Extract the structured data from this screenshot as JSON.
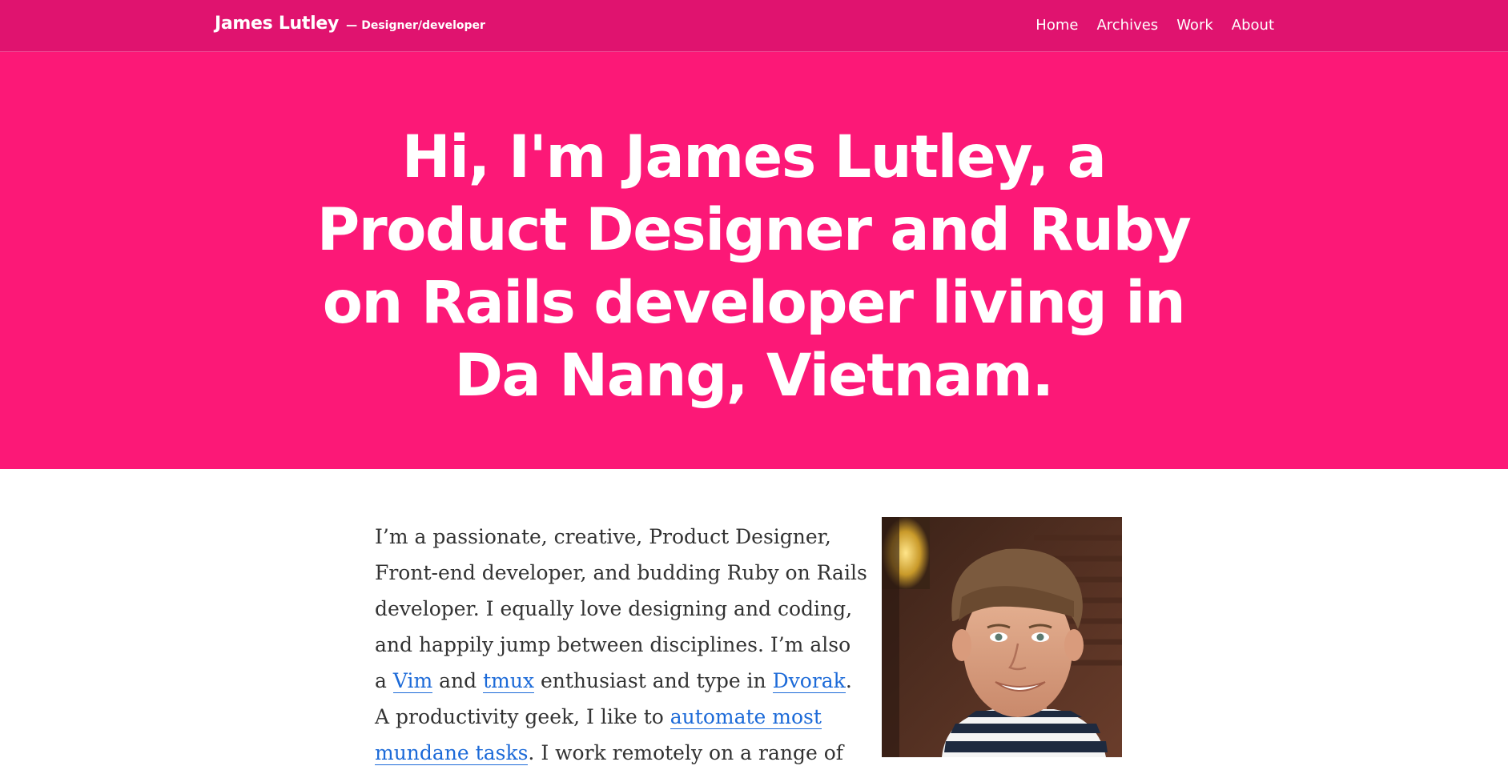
{
  "header": {
    "brand_name": "James Lutley",
    "brand_dash": "—",
    "brand_tagline": "Designer/developer",
    "nav": [
      {
        "label": "Home"
      },
      {
        "label": "Archives"
      },
      {
        "label": "Work"
      },
      {
        "label": "About"
      }
    ]
  },
  "hero": {
    "title": "Hi, I'm James Lutley, a Product Designer and Ruby on Rails developer living in Da Nang, Vietnam."
  },
  "intro": {
    "text_1": "I’m a passionate, creative, Product Designer, Front-end developer, and budding Ruby on Rails developer. I equally love designing and coding, and happily jump between disciplines. I’m also a ",
    "link_vim": "Vim",
    "text_2": " and ",
    "link_tmux": "tmux",
    "text_3": " enthusiast and type in ",
    "link_dvorak": "Dvorak",
    "text_4": ". A productivity geek, I like to ",
    "link_automate": "automate most mundane tasks",
    "text_5": ". I work remotely on a range of"
  },
  "colors": {
    "header_bg": "#e0136f",
    "hero_bg": "#fc1877",
    "link": "#1c6ad8",
    "body_text": "#333333"
  }
}
